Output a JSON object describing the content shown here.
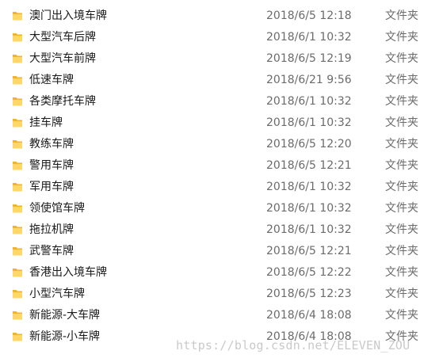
{
  "folder_icon": "folder-icon",
  "colors": {
    "folder_body": "#f0b432",
    "folder_front": "#ffd766"
  },
  "files": [
    {
      "name": "澳门出入境车牌",
      "date": "2018/6/5 12:18",
      "type": "文件夹"
    },
    {
      "name": "大型汽车后牌",
      "date": "2018/6/1 10:32",
      "type": "文件夹"
    },
    {
      "name": "大型汽车前牌",
      "date": "2018/6/5 12:19",
      "type": "文件夹"
    },
    {
      "name": "低速车牌",
      "date": "2018/6/21 9:56",
      "type": "文件夹"
    },
    {
      "name": "各类摩托车牌",
      "date": "2018/6/1 10:32",
      "type": "文件夹"
    },
    {
      "name": "挂车牌",
      "date": "2018/6/1 10:32",
      "type": "文件夹"
    },
    {
      "name": "教练车牌",
      "date": "2018/6/5 12:20",
      "type": "文件夹"
    },
    {
      "name": "警用车牌",
      "date": "2018/6/5 12:21",
      "type": "文件夹"
    },
    {
      "name": "军用车牌",
      "date": "2018/6/1 10:32",
      "type": "文件夹"
    },
    {
      "name": "领使馆车牌",
      "date": "2018/6/1 10:32",
      "type": "文件夹"
    },
    {
      "name": "拖拉机牌",
      "date": "2018/6/1 10:32",
      "type": "文件夹"
    },
    {
      "name": "武警车牌",
      "date": "2018/6/5 12:21",
      "type": "文件夹"
    },
    {
      "name": "香港出入境车牌",
      "date": "2018/6/5 12:22",
      "type": "文件夹"
    },
    {
      "name": "小型汽车牌",
      "date": "2018/6/5 12:23",
      "type": "文件夹"
    },
    {
      "name": "新能源-大车牌",
      "date": "2018/6/4 18:08",
      "type": "文件夹"
    },
    {
      "name": "新能源-小车牌",
      "date": "2018/6/4 18:08",
      "type": "文件夹"
    }
  ],
  "watermark": "https://blog.csdn.net/ELEVEN_ZOU"
}
